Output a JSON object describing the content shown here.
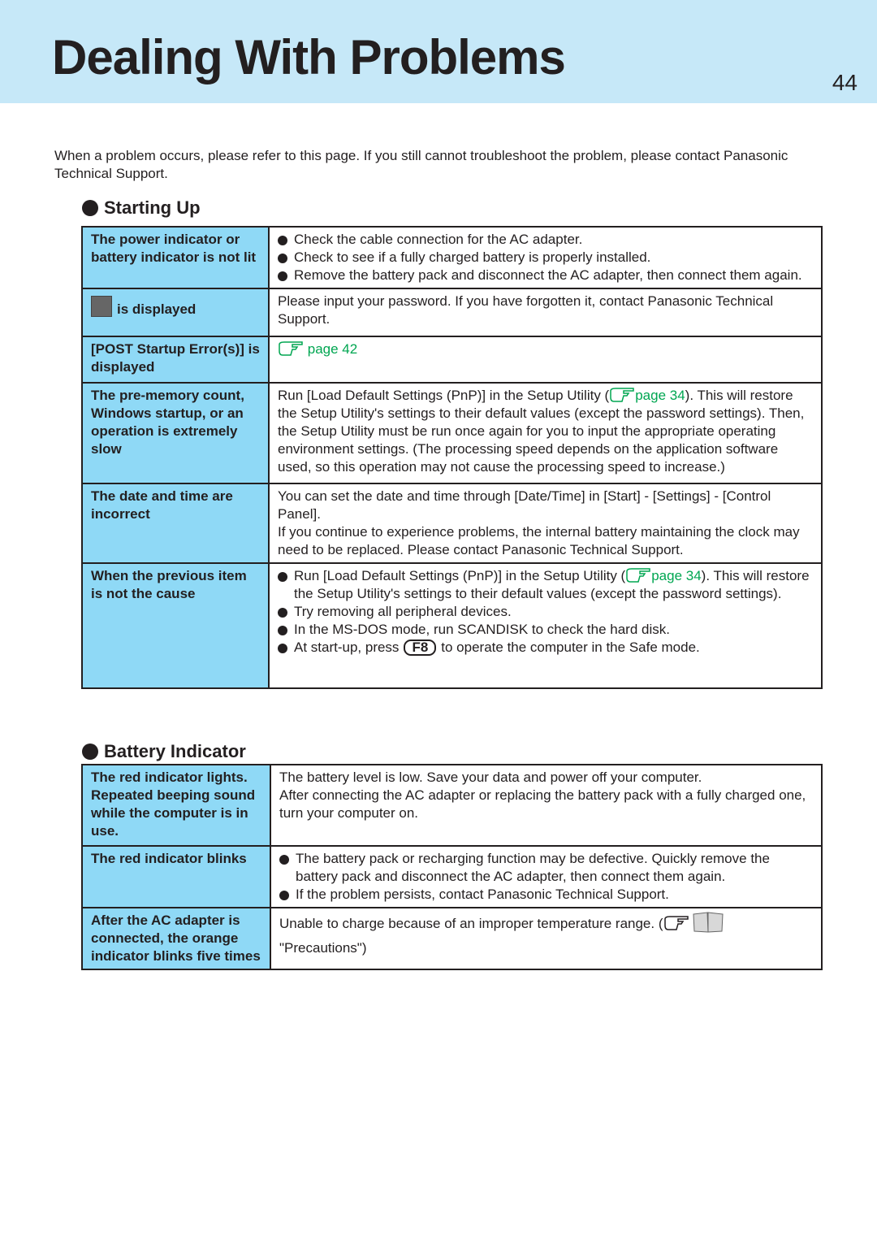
{
  "header": {
    "title": "Dealing With Problems",
    "page_number": "44"
  },
  "intro": "When a problem occurs, please refer to this page.  If you still cannot troubleshoot the problem, please contact Panasonic Technical Support.",
  "starting_up": {
    "heading": "Starting Up",
    "rows": [
      {
        "problem": "The power indicator or battery indicator is not lit",
        "bullets": [
          "Check the cable connection for the AC adapter.",
          "Check to see if a fully charged battery is properly installed.",
          "Remove the battery pack and disconnect the AC adapter, then connect them again."
        ]
      },
      {
        "problem": "is displayed",
        "icon": "password-key-icon",
        "text": "Please input your password.  If you have forgotten it, contact Panasonic Technical Support."
      },
      {
        "problem": "[POST Startup Error(s)] is displayed",
        "link": "page 42"
      },
      {
        "problem": "The pre-memory count, Windows startup, or an operation is extremely slow",
        "text_a": "Run [Load Default Settings (PnP)] in the Setup Utility (",
        "link": "page 34",
        "text_b": ").  This will restore the Setup Utility's settings to their default values (except the password settings).  Then, the Setup Utility must be run once again for you to input the appropriate operating environment settings.  (The processing speed depends on the application software used, so this operation may not cause the processing speed to increase.)"
      },
      {
        "problem": "The date and time are incorrect",
        "text": "You can set the date and time through [Date/Time] in [Start] - [Settings] - [Control Panel].",
        "text2": "If you continue to experience problems, the internal battery maintaining the clock may need to be replaced.  Please contact Panasonic Technical Support."
      },
      {
        "problem": "When the previous item is not the cause",
        "b1a": "Run [Load Default Settings (PnP)] in the Setup Utility (",
        "b1link": "page 34",
        "b1b": ").  This will restore the Setup Utility's settings to their default values (except the password settings).",
        "b2": "Try removing all peripheral devices.",
        "b3": "In the MS-DOS mode, run SCANDISK to check the hard disk.",
        "b4a": "At start-up, press",
        "b4key": "F8",
        "b4b": "to operate the computer in the Safe mode."
      }
    ]
  },
  "battery": {
    "heading": "Battery Indicator",
    "rows": [
      {
        "problem": "The red indicator lights. Repeated beeping sound while the computer is in use.",
        "text": "The battery level is low.  Save your data and power off your computer.",
        "text2": "After connecting the AC adapter or replacing the battery pack with a fully charged one, turn your computer on."
      },
      {
        "problem": "The red indicator blinks",
        "bullets": [
          "The battery pack or recharging function may be defective.  Quickly remove the battery pack and disconnect the AC adapter, then connect them again.",
          "If the problem persists, contact Panasonic Technical Support."
        ]
      },
      {
        "problem": "After the AC adapter is connected, the orange indicator blinks five times",
        "text_a": "Unable to charge because of an improper temperature range. (",
        "text_b": "\"Precautions\")"
      }
    ]
  },
  "colors": {
    "header_bg": "#c6e8f8",
    "cell_bg": "#8fd9f6",
    "link": "#00a651"
  }
}
